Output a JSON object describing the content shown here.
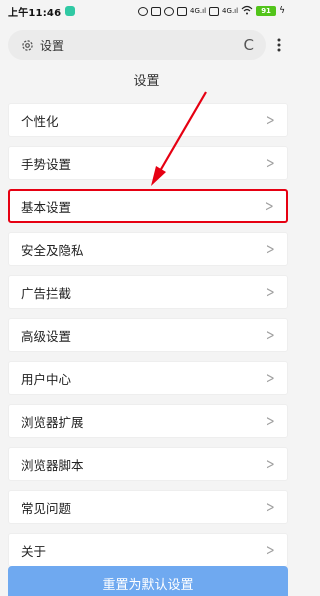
{
  "status_bar": {
    "time": "上午11:46",
    "battery": "91",
    "signal_1": "4G",
    "signal_2": "4G"
  },
  "url_bar": {
    "text": "设置",
    "icon": "gear-icon",
    "refresh_icon": "refresh-icon",
    "more_icon": "more-icon"
  },
  "page": {
    "title": "设置"
  },
  "menu": {
    "items": [
      {
        "label": "个性化"
      },
      {
        "label": "手势设置"
      },
      {
        "label": "基本设置",
        "highlighted": true
      },
      {
        "label": "安全及隐私"
      },
      {
        "label": "广告拦截"
      },
      {
        "label": "高级设置"
      },
      {
        "label": "用户中心"
      },
      {
        "label": "浏览器扩展"
      },
      {
        "label": "浏览器脚本"
      },
      {
        "label": "常见问题"
      },
      {
        "label": "关于"
      }
    ]
  },
  "reset_button": {
    "label": "重置为默认设置"
  },
  "colors": {
    "highlight_border": "#e60012",
    "annotation_arrow": "#e60012",
    "reset_button_bg": "#6fa9f0",
    "battery_bg": "#52c41a"
  }
}
